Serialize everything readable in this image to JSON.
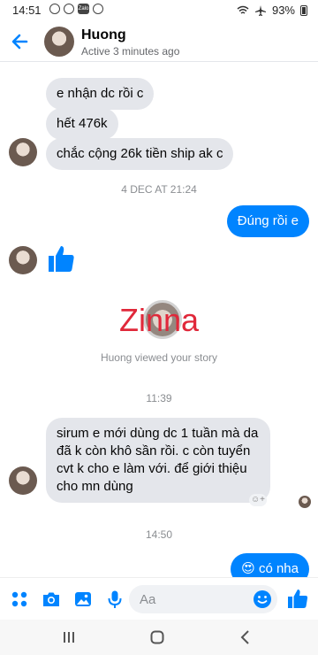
{
  "status_bar": {
    "time": "14:51",
    "battery": "93%"
  },
  "header": {
    "name": "Huong",
    "status": "Active 3 minutes ago"
  },
  "messages": {
    "m1": "e nhận dc rồi c",
    "m2": "hết 476k",
    "m3": "chắc cộng 26k tiền ship ak c",
    "ts1": "4 DEC AT 21:24",
    "out1": "Đúng rồi e",
    "story_logo": "Zinna",
    "story_caption": "Huong viewed your story",
    "ts2": "11:39",
    "m4": "sirum e mới dùng dc 1 tuần mà da đã k còn khô sần rồi. c còn tuyển cvt k cho e làm với. để giới thiệu cho mn dùng",
    "ts3": "14:50",
    "out2_emoji": "😍",
    "out2_text": "có nha"
  },
  "composer": {
    "placeholder": "Aa"
  },
  "colors": {
    "accent": "#0084ff",
    "incoming_bubble": "#e4e6eb",
    "story_logo": "#e0283a"
  },
  "icons": [
    "back-arrow-icon",
    "phone-icon",
    "video-camera-icon",
    "info-icon",
    "thumbs-up-icon",
    "apps-grid-icon",
    "camera-icon",
    "gallery-icon",
    "microphone-icon",
    "emoji-icon",
    "like-icon"
  ]
}
